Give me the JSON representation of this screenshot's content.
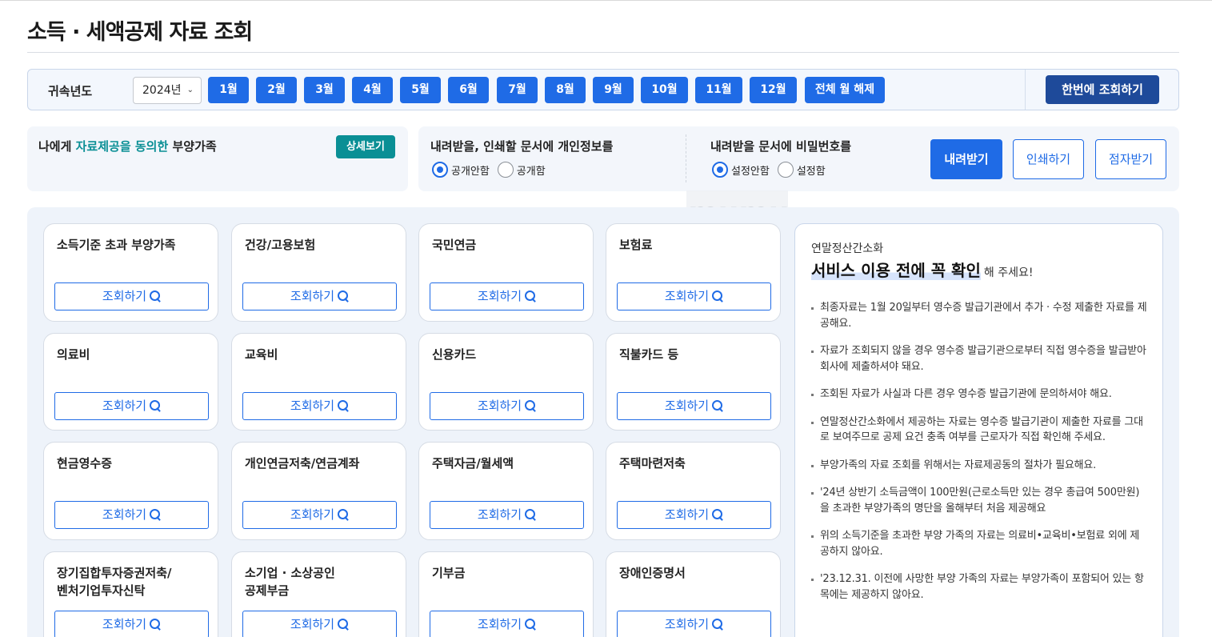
{
  "page_title": "소득 · 세액공제 자료 조회",
  "year_bar": {
    "label": "귀속년도",
    "year_value": "2024년",
    "months": [
      "1월",
      "2월",
      "3월",
      "4월",
      "5월",
      "6월",
      "7월",
      "8월",
      "9월",
      "10월",
      "11월",
      "12월"
    ],
    "clear_all_label": "전체 월 해제",
    "query_all_label": "한번에 조회하기"
  },
  "consent": {
    "prefix": "나에게 ",
    "highlight": "자료제공을 동의한",
    "suffix": " 부양가족",
    "detail_label": "상세보기"
  },
  "options": {
    "privacy_title": "내려받을, 인쇄할 문서에 개인정보를",
    "privacy_options": [
      "공개안함",
      "공개함"
    ],
    "privacy_selected": "공개안함",
    "password_title": "내려받을 문서에 비밀번호를",
    "password_options": [
      "설정안함",
      "설정함"
    ],
    "password_selected": "설정안함",
    "download_label": "내려받기",
    "print_label": "인쇄하기",
    "braille_label": "점자받기"
  },
  "watermark": "mumu",
  "cards": [
    {
      "title": "소득기준 초과 부양가족",
      "button": "조회하기"
    },
    {
      "title": "건강/고용보험",
      "button": "조회하기"
    },
    {
      "title": "국민연금",
      "button": "조회하기"
    },
    {
      "title": "보험료",
      "button": "조회하기"
    },
    {
      "title": "의료비",
      "button": "조회하기"
    },
    {
      "title": "교육비",
      "button": "조회하기"
    },
    {
      "title": "신용카드",
      "button": "조회하기"
    },
    {
      "title": "직불카드 등",
      "button": "조회하기"
    },
    {
      "title": "현금영수증",
      "button": "조회하기"
    },
    {
      "title": "개인연금저축/연금계좌",
      "button": "조회하기"
    },
    {
      "title": "주택자금/월세액",
      "button": "조회하기"
    },
    {
      "title": "주택마련저축",
      "button": "조회하기"
    },
    {
      "title_line1": "장기집합투자증권저축/",
      "title_line2": "벤처기업투자신탁",
      "button": "조회하기"
    },
    {
      "title_line1": "소기업 · 소상공인",
      "title_line2": "공제부금",
      "button": "조회하기"
    },
    {
      "title": "기부금",
      "button": "조회하기"
    },
    {
      "title": "장애인증명서",
      "button": "조회하기"
    }
  ],
  "notice": {
    "subtitle": "연말정산간소화",
    "title": "서비스 이용 전에 꼭 확인",
    "title_suffix": "해 주세요!",
    "items": [
      "최종자료는 1월 20일부터 영수증 발급기관에서 추가 · 수정 제출한 자료를 제공해요.",
      "자료가 조회되지 않을 경우 영수증 발급기관으로부터 직접 영수증을 발급받아 회사에 제출하셔야 돼요.",
      "조회된 자료가 사실과 다른 경우 영수증 발급기관에 문의하셔야 해요.",
      "연말정산간소화에서 제공하는 자료는 영수증 발급기관이 제출한 자료를 그대로 보여주므로 공제 요건 충족 여부를 근로자가 직접 확인해 주세요.",
      "부양가족의 자료 조회를 위해서는 자료제공동의 절차가 필요해요.",
      "'24년 상반기 소득금액이 100만원(근로소득만 있는 경우 총급여 500만원)을 초과한 부양가족의 명단을 올해부터 처음 제공해요",
      "위의 소득기준을 초과한 부양 가족의 자료는 의료비•교육비•보험료 외에 제공하지 않아요.",
      "'23.12.31. 이전에 사망한 부양 가족의 자료는 부양가족이 포함되어 있는 항목에는 제공하지 않아요."
    ]
  }
}
